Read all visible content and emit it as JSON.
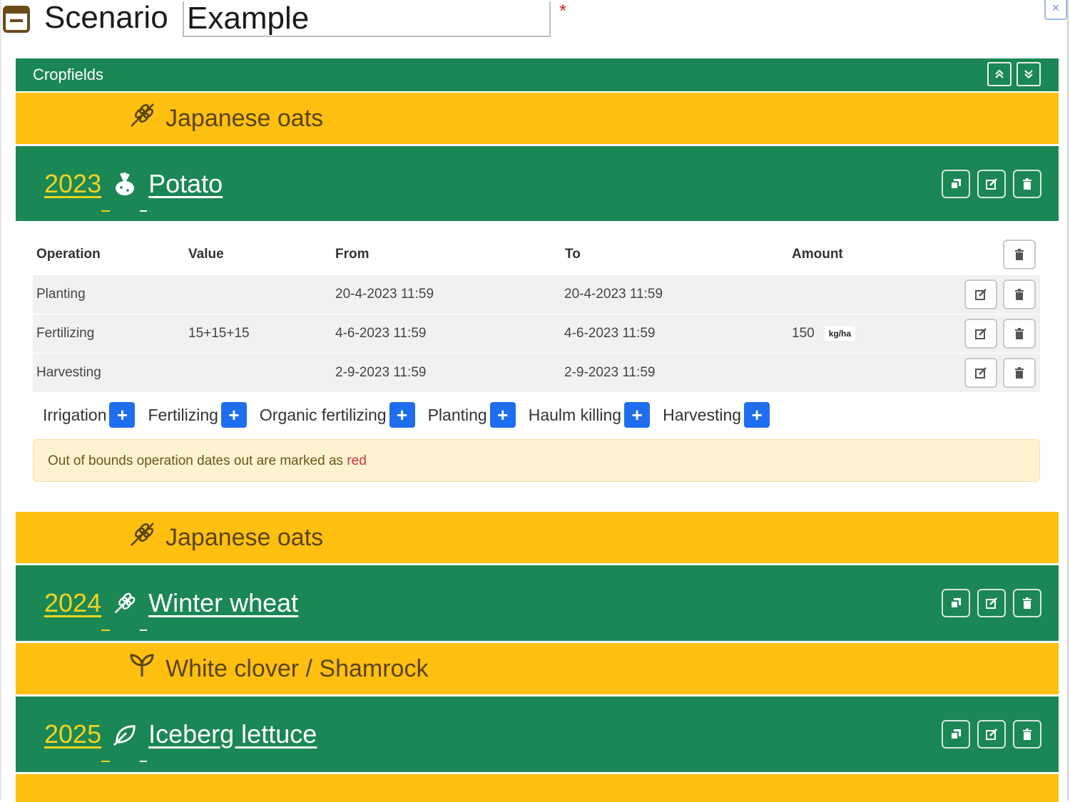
{
  "header": {
    "label": "Scenario",
    "name_value": "Example",
    "required_mark": "*",
    "close_label": "×"
  },
  "panel": {
    "title": "Cropfields",
    "collapse_all_icon": "chevron-double-up-icon",
    "expand_all_icon": "chevron-double-down-icon"
  },
  "rows": {
    "catch1": {
      "name": "Japanese oats",
      "icon": "wheat-icon"
    },
    "crop1": {
      "year": "2023",
      "name": "Potato",
      "icon": "potato-icon"
    },
    "catch2": {
      "name": "Japanese oats",
      "icon": "wheat-icon"
    },
    "crop2": {
      "year": "2024",
      "name": "Winter wheat",
      "icon": "wheat-icon"
    },
    "catch3": {
      "name": "White clover / Shamrock",
      "icon": "seedling-icon"
    },
    "crop3": {
      "year": "2025",
      "name": "Iceberg lettuce",
      "icon": "leaf-icon"
    }
  },
  "operations": {
    "headers": {
      "operation": "Operation",
      "value": "Value",
      "from": "From",
      "to": "To",
      "amount": "Amount"
    },
    "rows": [
      {
        "operation": "Planting",
        "value": "",
        "from": "20-4-2023 11:59",
        "to": "20-4-2023 11:59",
        "amount": "",
        "unit": ""
      },
      {
        "operation": "Fertilizing",
        "value": "15+15+15",
        "from": "4-6-2023 11:59",
        "to": "4-6-2023 11:59",
        "amount": "150",
        "unit": "kg/ha"
      },
      {
        "operation": "Harvesting",
        "value": "",
        "from": "2-9-2023 11:59",
        "to": "2-9-2023 11:59",
        "amount": "",
        "unit": ""
      }
    ],
    "add_buttons": [
      {
        "label": "Irrigation"
      },
      {
        "label": "Fertilizing"
      },
      {
        "label": "Organic fertilizing"
      },
      {
        "label": "Planting"
      },
      {
        "label": "Haulm killing"
      },
      {
        "label": "Harvesting"
      }
    ],
    "alert": {
      "text": "Out of bounds operation dates out are marked as ",
      "highlight": "red"
    }
  },
  "colors": {
    "green": "#1b8754",
    "yellow": "#fdc010",
    "year_text": "#f2d31f",
    "add_button": "#1f6ef0",
    "alert_bg": "#fdf3d3",
    "alert_red": "#d2322d"
  }
}
